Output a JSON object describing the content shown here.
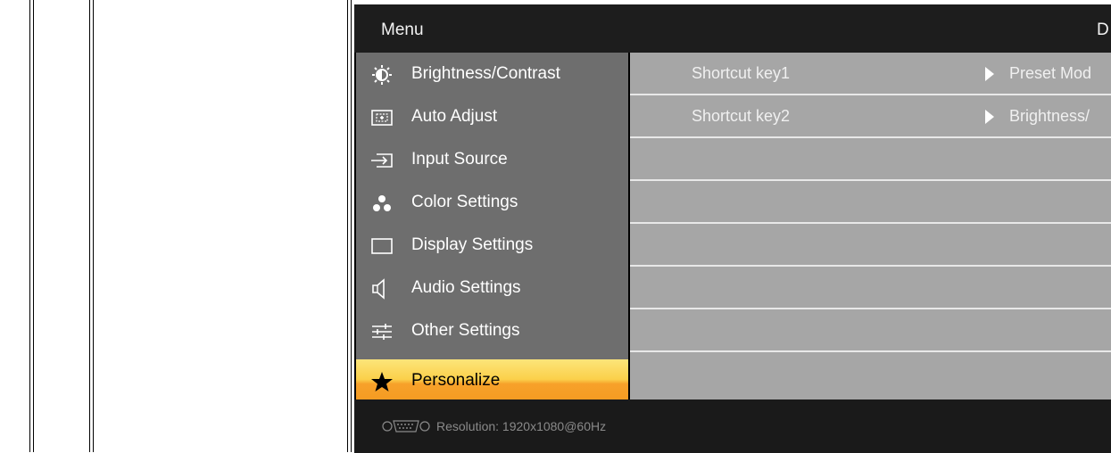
{
  "header": {
    "title": "Menu",
    "truncated_label": "D"
  },
  "menu": {
    "items": [
      {
        "label": "Brightness/Contrast",
        "icon": "brightness-icon"
      },
      {
        "label": "Auto Adjust",
        "icon": "auto-adjust-icon"
      },
      {
        "label": "Input Source",
        "icon": "input-source-icon"
      },
      {
        "label": "Color Settings",
        "icon": "color-settings-icon"
      },
      {
        "label": "Display Settings",
        "icon": "display-settings-icon"
      },
      {
        "label": "Audio Settings",
        "icon": "audio-settings-icon"
      },
      {
        "label": "Other Settings",
        "icon": "other-settings-icon"
      },
      {
        "label": "Personalize",
        "icon": "star-icon",
        "active": true
      }
    ]
  },
  "panel": {
    "rows": [
      {
        "key": "Shortcut key1",
        "value": "Preset Mod"
      },
      {
        "key": "Shortcut key2",
        "value": "Brightness/"
      }
    ]
  },
  "footer": {
    "resolution": "Resolution:  1920x1080@60Hz",
    "icon": "vga-connector-icon"
  },
  "colors": {
    "menu_bg": "#6e6e6e",
    "panel_bg": "#a6a6a6",
    "active_top": "#fce57a",
    "active_bottom": "#f59a20",
    "header_bg": "#1d1d1d"
  }
}
